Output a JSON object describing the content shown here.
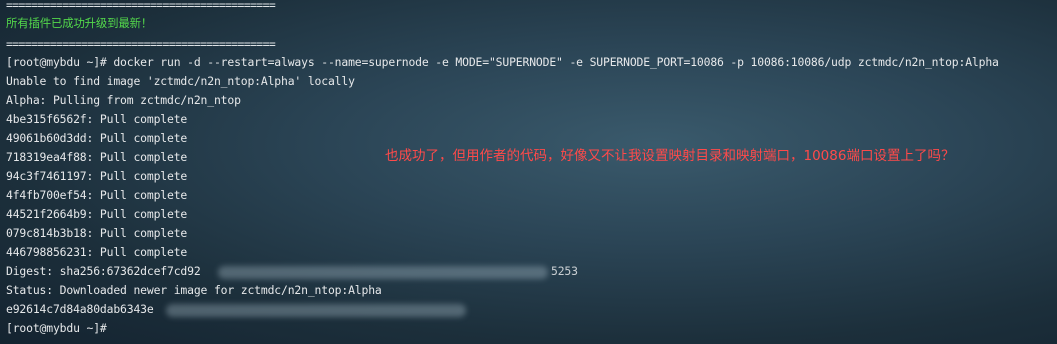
{
  "terminal": {
    "lines": [
      {
        "text": "==========================================="
      },
      {
        "text": "所有插件已成功升级到最新！"
      },
      {
        "text": "==========================================="
      },
      {
        "text": "[root@mybdu ~]# docker run -d --restart=always --name=supernode -e MODE=\"SUPERNODE\" -e SUPERNODE_PORT=10086 -p 10086:10086/udp zctmdc/n2n_ntop:Alpha"
      },
      {
        "text": "Unable to find image 'zctmdc/n2n_ntop:Alpha' locally"
      },
      {
        "text": "Alpha: Pulling from zctmdc/n2n_ntop"
      },
      {
        "text": "4be315f6562f: Pull complete"
      },
      {
        "text": "49061b60d3dd: Pull complete"
      },
      {
        "text": "718319ea4f88: Pull complete"
      },
      {
        "text": "94c3f7461197: Pull complete"
      },
      {
        "text": "4f4fb700ef54: Pull complete"
      },
      {
        "text": "44521f2664b9: Pull complete"
      },
      {
        "text": "079c814b3b18: Pull complete"
      },
      {
        "text": "446798856231: Pull complete"
      },
      {
        "text": "Digest: sha256:67362dcef7cd92"
      },
      {
        "text": "Status: Downloaded newer image for zctmdc/n2n_ntop:Alpha"
      },
      {
        "text": "e92614c7d84a80dab6343e"
      },
      {
        "text": "[root@mybdu ~]#"
      }
    ],
    "digest_tail": "5253"
  },
  "annotation": {
    "text": "也成功了，但用作者的代码，好像又不让我设置映射目录和映射端口，10086端口设置上了吗？"
  }
}
